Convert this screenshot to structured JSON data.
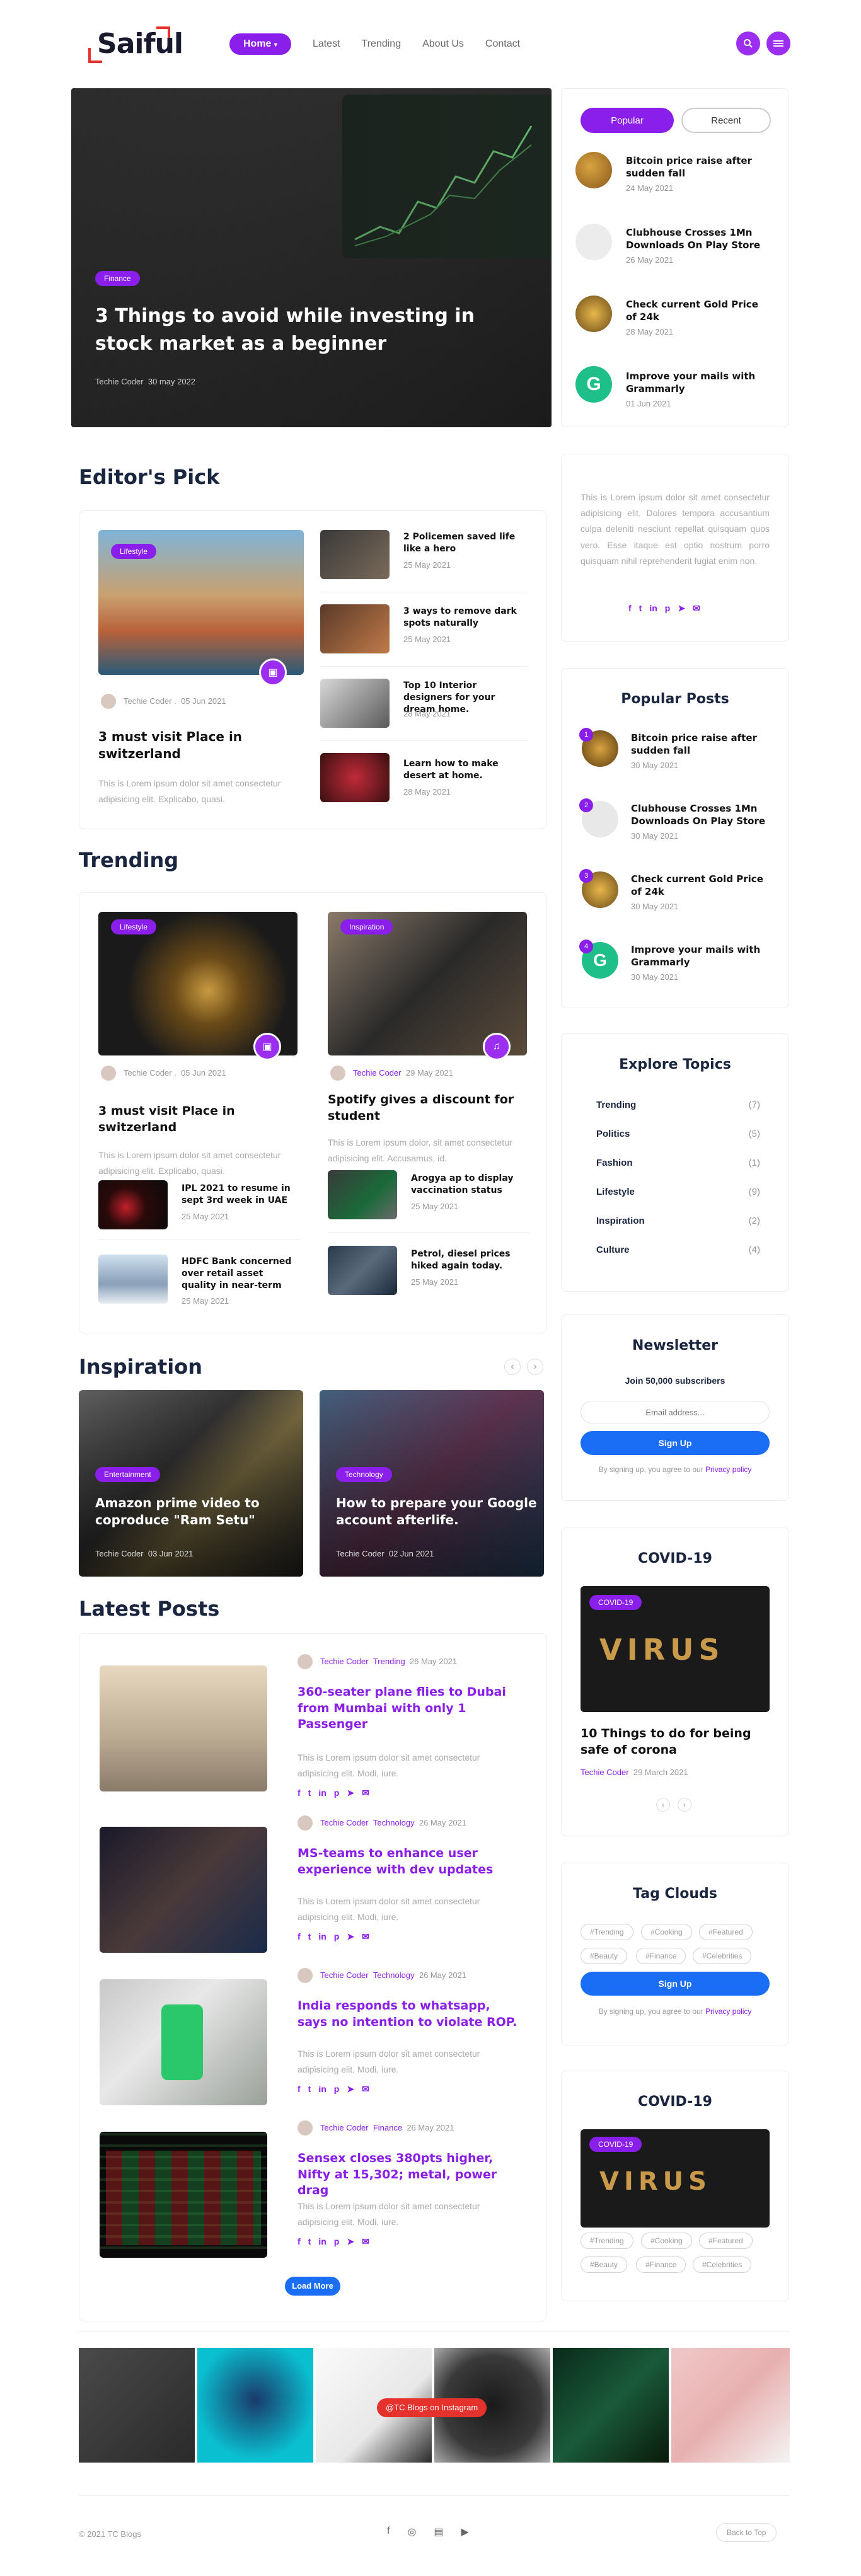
{
  "header": {
    "logo": "Saiful",
    "nav": [
      "Home",
      "Latest",
      "Trending",
      "About Us",
      "Contact"
    ],
    "home_caret": "▾"
  },
  "hero": {
    "tag": "Finance",
    "title": "3 Things to avoid while investing in stock market as a beginner",
    "author": "Techie Coder",
    "date": "30 may 2022"
  },
  "sidebar_tabs": {
    "popular": "Popular",
    "recent": "Recent",
    "items": [
      {
        "title": "Bitcoin price raise after sudden fall",
        "date": "24 May 2021"
      },
      {
        "title": "Clubhouse Crosses 1Mn Downloads On Play Store",
        "date": "26 May 2021"
      },
      {
        "title": "Check current Gold Price of 24k",
        "date": "28 May 2021"
      },
      {
        "title": "Improve your mails with Grammarly",
        "date": "01 Jun 2021"
      }
    ]
  },
  "about": {
    "text": "This is Lorem ipsum dolor sit amet consectetur adipisicing elit. Dolores tempora accusantium culpa deleniti nesciunt repellat quisquam quos vero. Esse itaque est optio nostrum porro quisquam nihil reprehenderit fugiat enim non."
  },
  "editors_pick": {
    "title": "Editor's Pick",
    "main": {
      "tag": "Lifestyle",
      "author": "Techie Coder .",
      "date": "05 Jun 2021",
      "title": "3 must visit Place in switzerland",
      "text": "This is Lorem ipsum dolor sit amet consectetur adipisicing elit. Explicabo, quasi."
    },
    "list": [
      {
        "title": "2 Policemen saved life like a hero",
        "date": "25 May 2021"
      },
      {
        "title": "3 ways to remove dark spots naturally",
        "date": "25 May 2021"
      },
      {
        "title": "Top 10 Interior designers for your dream home.",
        "date": "28 May 2021"
      },
      {
        "title": "Learn how to make desert at home.",
        "date": "28 May 2021"
      }
    ]
  },
  "popular_posts": {
    "title": "Popular Posts",
    "items": [
      {
        "num": "1",
        "title": "Bitcoin price raise after sudden fall",
        "date": "30 May 2021"
      },
      {
        "num": "2",
        "title": "Clubhouse Crosses 1Mn Downloads On Play Store",
        "date": "30 May 2021"
      },
      {
        "num": "3",
        "title": "Check current Gold Price of 24k",
        "date": "30 May 2021"
      },
      {
        "num": "4",
        "title": "Improve your mails with Grammarly",
        "date": "30 May 2021"
      }
    ]
  },
  "trending": {
    "title": "Trending",
    "card1": {
      "tag": "Lifestyle",
      "author": "Techie Coder .",
      "date": "05 Jun 2021",
      "title": "3 must visit Place in switzerland",
      "text": "This is Lorem ipsum dolor sit amet consectetur adipisicing elit. Explicabo, quasi."
    },
    "card2": {
      "tag": "Inspiration",
      "author": "Techie Coder",
      "date": "29 May 2021",
      "title": "Spotify gives a discount for student",
      "text": "This is Lorem ipsum dolor, sit amet consectetur adipisicing elit. Accusamus, id."
    },
    "list": [
      {
        "title": "IPL 2021 to resume in sept 3rd week in UAE",
        "date": "25 May 2021"
      },
      {
        "title": "Arogya ap to display vaccination status",
        "date": "25 May 2021"
      },
      {
        "title": "HDFC Bank concerned over retail asset quality in near-term",
        "date": "25 May 2021"
      },
      {
        "title": "Petrol, diesel prices hiked again today.",
        "date": "25 May 2021"
      }
    ]
  },
  "explore": {
    "title": "Explore Topics",
    "items": [
      {
        "name": "Trending",
        "count": "(7)"
      },
      {
        "name": "Politics",
        "count": "(5)"
      },
      {
        "name": "Fashion",
        "count": "(1)"
      },
      {
        "name": "Lifestyle",
        "count": "(9)"
      },
      {
        "name": "Inspiration",
        "count": "(2)"
      },
      {
        "name": "Culture",
        "count": "(4)"
      }
    ]
  },
  "newsletter": {
    "title": "Newsletter",
    "subtitle": "Join 50,000 subscribers",
    "placeholder": "Email address...",
    "button": "Sign Up",
    "note": "By signing up, you agree to our",
    "link": "Privacy policy"
  },
  "inspiration": {
    "title": "Inspiration",
    "prev": "‹",
    "next": "›",
    "cards": [
      {
        "tag": "Entertainment",
        "title": "Amazon prime video to coproduce \"Ram Setu\"",
        "author": "Techie Coder",
        "date": "03 Jun 2021"
      },
      {
        "tag": "Technology",
        "title": "How to prepare your Google account afterlife.",
        "author": "Techie Coder",
        "date": "02 Jun 2021"
      }
    ]
  },
  "covid1": {
    "title": "COVID-19",
    "tag": "COVID-19",
    "headline": "10 Things to do for being safe of corona",
    "author": "Techie Coder",
    "date": "29 March 2021",
    "prev": "‹",
    "next": "›"
  },
  "latest": {
    "title": "Latest Posts",
    "posts": [
      {
        "author": "Techie Coder",
        "cat": "Trending",
        "date": "26 May 2021",
        "title": "360-seater plane flies to Dubai from Mumbai with only 1 Passenger",
        "text": "This is Lorem ipsum dolor sit amet consectetur adipisicing elit. Modi, iure."
      },
      {
        "author": "Techie Coder",
        "cat": "Technology",
        "date": "26 May 2021",
        "title": "MS-teams to enhance user experience with dev updates",
        "text": "This is Lorem ipsum dolor sit amet consectetur adipisicing elit. Modi, iure."
      },
      {
        "author": "Techie Coder",
        "cat": "Technology",
        "date": "26 May 2021",
        "title": "India responds to whatsapp, says no intention to violate ROP.",
        "text": "This is Lorem ipsum dolor sit amet consectetur adipisicing elit. Modi, iure."
      },
      {
        "author": "Techie Coder",
        "cat": "Finance",
        "date": "26 May 2021",
        "title": "Sensex closes 380pts higher, Nifty at 15,302; metal, power drag",
        "text": "This is Lorem ipsum dolor sit amet consectetur adipisicing elit. Modi, iure."
      }
    ],
    "load_more": "Load More"
  },
  "tags": {
    "title": "Tag Clouds",
    "items": [
      "#Trending",
      "#Cooking",
      "#Featured",
      "#Beauty",
      "#Finance",
      "#Celebrities"
    ],
    "button": "Sign Up",
    "note": "By signing up, you agree to our",
    "link": "Privacy policy"
  },
  "covid2": {
    "title": "COVID-19",
    "tag": "COVID-19",
    "items": [
      "#Trending",
      "#Cooking",
      "#Featured",
      "#Beauty",
      "#Finance",
      "#Celebrities"
    ]
  },
  "instagram": {
    "label": "@TC Blogs on Instagram"
  },
  "footer": {
    "copyright": "© 2021 TC Blogs",
    "back_to_top": "Back to Top"
  },
  "colors": {
    "accent": "#8a1eea",
    "blue": "#1a6ef5",
    "logo_red": "#e5322d"
  }
}
